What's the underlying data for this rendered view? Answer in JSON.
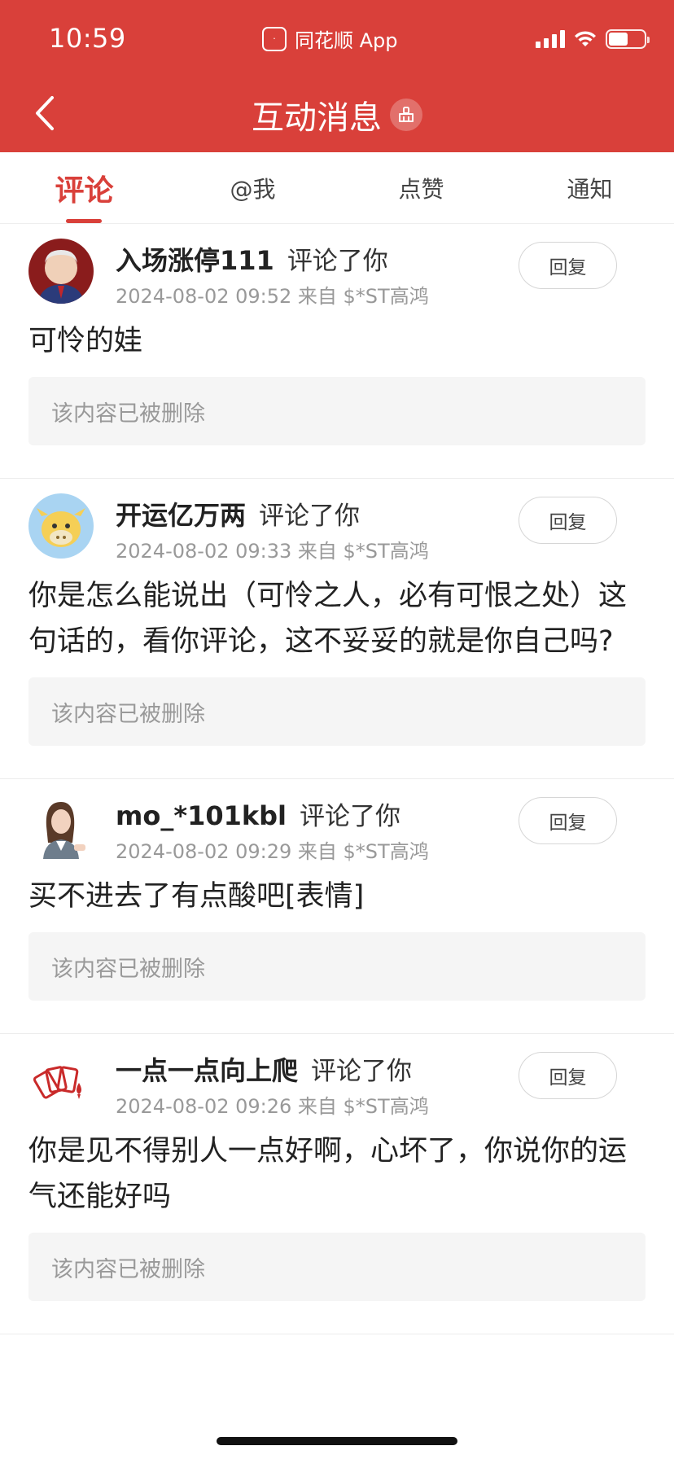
{
  "status_bar": {
    "time": "10:59",
    "carrier_app": "同花顺 App",
    "battery_level": 0.55
  },
  "header": {
    "title": "互动消息",
    "back_icon": "chevron-left-icon",
    "clear_icon": "broom-icon"
  },
  "tabs": [
    {
      "label": "评论",
      "active": true
    },
    {
      "label": "@我",
      "active": false
    },
    {
      "label": "点赞",
      "active": false
    },
    {
      "label": "通知",
      "active": false
    }
  ],
  "comments": [
    {
      "username": "入场涨停111",
      "action": "评论了你",
      "meta": "2024-08-02 09:52 来自 $*ST高鸿",
      "reply_label": "回复",
      "content": "可怜的娃",
      "quoted": "该内容已被删除"
    },
    {
      "username": "开运亿万两",
      "action": "评论了你",
      "meta": "2024-08-02 09:33 来自 $*ST高鸿",
      "reply_label": "回复",
      "content": "你是怎么能说出（可怜之人，必有可恨之处）这句话的，看你评论，这不妥妥的就是你自己吗?",
      "quoted": "该内容已被删除"
    },
    {
      "username": "mo_*101kbl",
      "action": "评论了你",
      "meta": "2024-08-02 09:29 来自 $*ST高鸿",
      "reply_label": "回复",
      "content": "买不进去了有点酸吧[表情]",
      "quoted": "该内容已被删除"
    },
    {
      "username": "一点一点向上爬",
      "action": "评论了你",
      "meta": "2024-08-02 09:26 来自 $*ST高鸿",
      "reply_label": "回复",
      "content": "你是见不得别人一点好啊，心坏了，你说你的运气还能好吗",
      "quoted": "该内容已被删除"
    }
  ],
  "colors": {
    "brand": "#d9403a",
    "muted": "#999999"
  }
}
